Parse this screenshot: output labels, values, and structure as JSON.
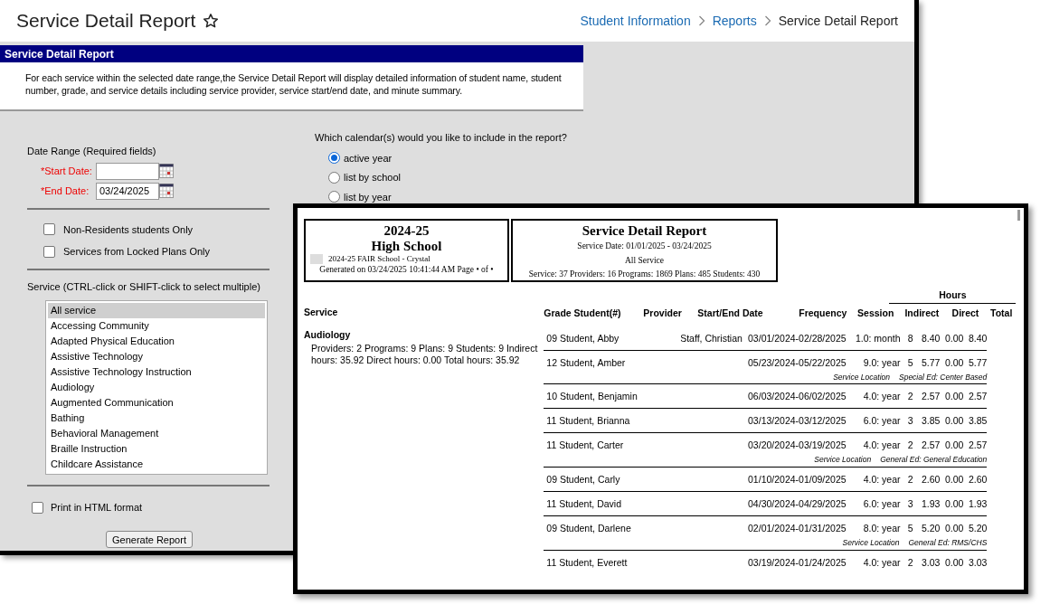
{
  "page_header": {
    "title": "Service Detail Report",
    "breadcrumbs": [
      {
        "label": "Student Information",
        "kind": "link"
      },
      {
        "label": "Reports",
        "kind": "link"
      },
      {
        "label": "Service Detail Report",
        "kind": "current"
      }
    ]
  },
  "panel": {
    "title": "Service Detail Report",
    "description": "For each service within the selected date range,the Service Detail Report will display detailed information of student name, student number, grade, and service details including service provider, service start/end date, and minute summary."
  },
  "form": {
    "date_range_label": "Date Range (Required fields)",
    "date_fields": [
      {
        "label": "*Start Date:"
      },
      {
        "label": "*End Date:",
        "value": "03/24/2025"
      }
    ],
    "filters": [
      {
        "label": "Non-Residents students Only",
        "checked": false
      },
      {
        "label": "Services from Locked Plans Only",
        "checked": false
      }
    ],
    "service_label": "Service (CTRL-click or SHIFT-click to select multiple)",
    "services": [
      {
        "label": "All service",
        "selected": true
      },
      {
        "label": "Accessing Community",
        "selected": false
      },
      {
        "label": "Adapted Physical Education",
        "selected": false
      },
      {
        "label": "Assistive Technology",
        "selected": false
      },
      {
        "label": "Assistive Technology Instruction",
        "selected": false
      },
      {
        "label": "Audiology",
        "selected": false
      },
      {
        "label": "Augmented Communication",
        "selected": false
      },
      {
        "label": "Bathing",
        "selected": false
      },
      {
        "label": "Behavioral Management",
        "selected": false
      },
      {
        "label": "Braille Instruction",
        "selected": false
      },
      {
        "label": "Childcare Assistance",
        "selected": false
      }
    ],
    "print_html": {
      "label": "Print in HTML format",
      "checked": false
    },
    "generate_button": "Generate Report",
    "calendar_question": "Which calendar(s) would you like to include in the report?",
    "calendar_options": [
      {
        "label": "active year",
        "selected": true
      },
      {
        "label": "list by school",
        "selected": false
      },
      {
        "label": "list by year",
        "selected": false
      }
    ]
  },
  "report": {
    "school_box": {
      "year": "2024-25",
      "school": "High School",
      "subtitle": "2024-25 FAIR School - Crystal",
      "generated": "Generated on 03/24/2025 10:41:44 AM Page • of •"
    },
    "title_box": {
      "title": "Service Detail Report",
      "service_date": "Service Date: 01/01/2025 - 03/24/2025",
      "scope": "All Service",
      "summary": "Service: 37 Providers: 16 Programs: 1869 Plans: 485 Students: 430"
    },
    "hours_header": "Hours",
    "columns": [
      "Service",
      "Grade Student(#)",
      "Provider",
      "Start/End Date",
      "Frequency",
      "Session",
      "Indirect",
      "Direct",
      "Total"
    ],
    "service_name": "Audiology",
    "service_summary": "Providers: 2 Programs: 9 Plans: 9 Students: 9 Indirect hours: 35.92 Direct hours: 0.00 Total hours: 35.92",
    "rows": [
      {
        "student": "09 Student, Abby",
        "provider": "Staff, Christian",
        "dates": "03/01/2024-02/28/2025",
        "frequency": "1.0: month",
        "session": "8",
        "indirect": "8.40",
        "direct": "0.00",
        "total": "8.40"
      },
      {
        "student": "12 Student, Amber",
        "dates": "05/23/2024-05/22/2025",
        "frequency": "9.0: year",
        "session": "5",
        "indirect": "5.77",
        "direct": "0.00",
        "total": "5.77",
        "location_label": "Service Location",
        "location": "Special Ed: Center Based"
      },
      {
        "student": "10 Student, Benjamin",
        "dates": "06/03/2024-06/02/2025",
        "frequency": "4.0: year",
        "session": "2",
        "indirect": "2.57",
        "direct": "0.00",
        "total": "2.57"
      },
      {
        "student": "11 Student, Brianna",
        "dates": "03/13/2024-03/12/2025",
        "frequency": "6.0: year",
        "session": "3",
        "indirect": "3.85",
        "direct": "0.00",
        "total": "3.85"
      },
      {
        "student": "11 Student, Carter",
        "dates": "03/20/2024-03/19/2025",
        "frequency": "4.0: year",
        "session": "2",
        "indirect": "2.57",
        "direct": "0.00",
        "total": "2.57",
        "location_label": "Service Location",
        "location": "General Ed: General Education"
      },
      {
        "student": "09 Student, Carly",
        "dates": "01/10/2024-01/09/2025",
        "frequency": "4.0: year",
        "session": "2",
        "indirect": "2.60",
        "direct": "0.00",
        "total": "2.60"
      },
      {
        "student": "11 Student, David",
        "dates": "04/30/2024-04/29/2025",
        "frequency": "6.0: year",
        "session": "3",
        "indirect": "1.93",
        "direct": "0.00",
        "total": "1.93"
      },
      {
        "student": "09 Student, Darlene",
        "dates": "02/01/2024-01/31/2025",
        "frequency": "8.0: year",
        "session": "5",
        "indirect": "5.20",
        "direct": "0.00",
        "total": "5.20",
        "location_label": "Service Location",
        "location": "General Ed: RMS/CHS"
      },
      {
        "student": "11 Student, Everett",
        "dates": "03/19/2024-01/24/2025",
        "frequency": "4.0: year",
        "session": "2",
        "indirect": "3.03",
        "direct": "0.00",
        "total": "3.03"
      }
    ]
  }
}
